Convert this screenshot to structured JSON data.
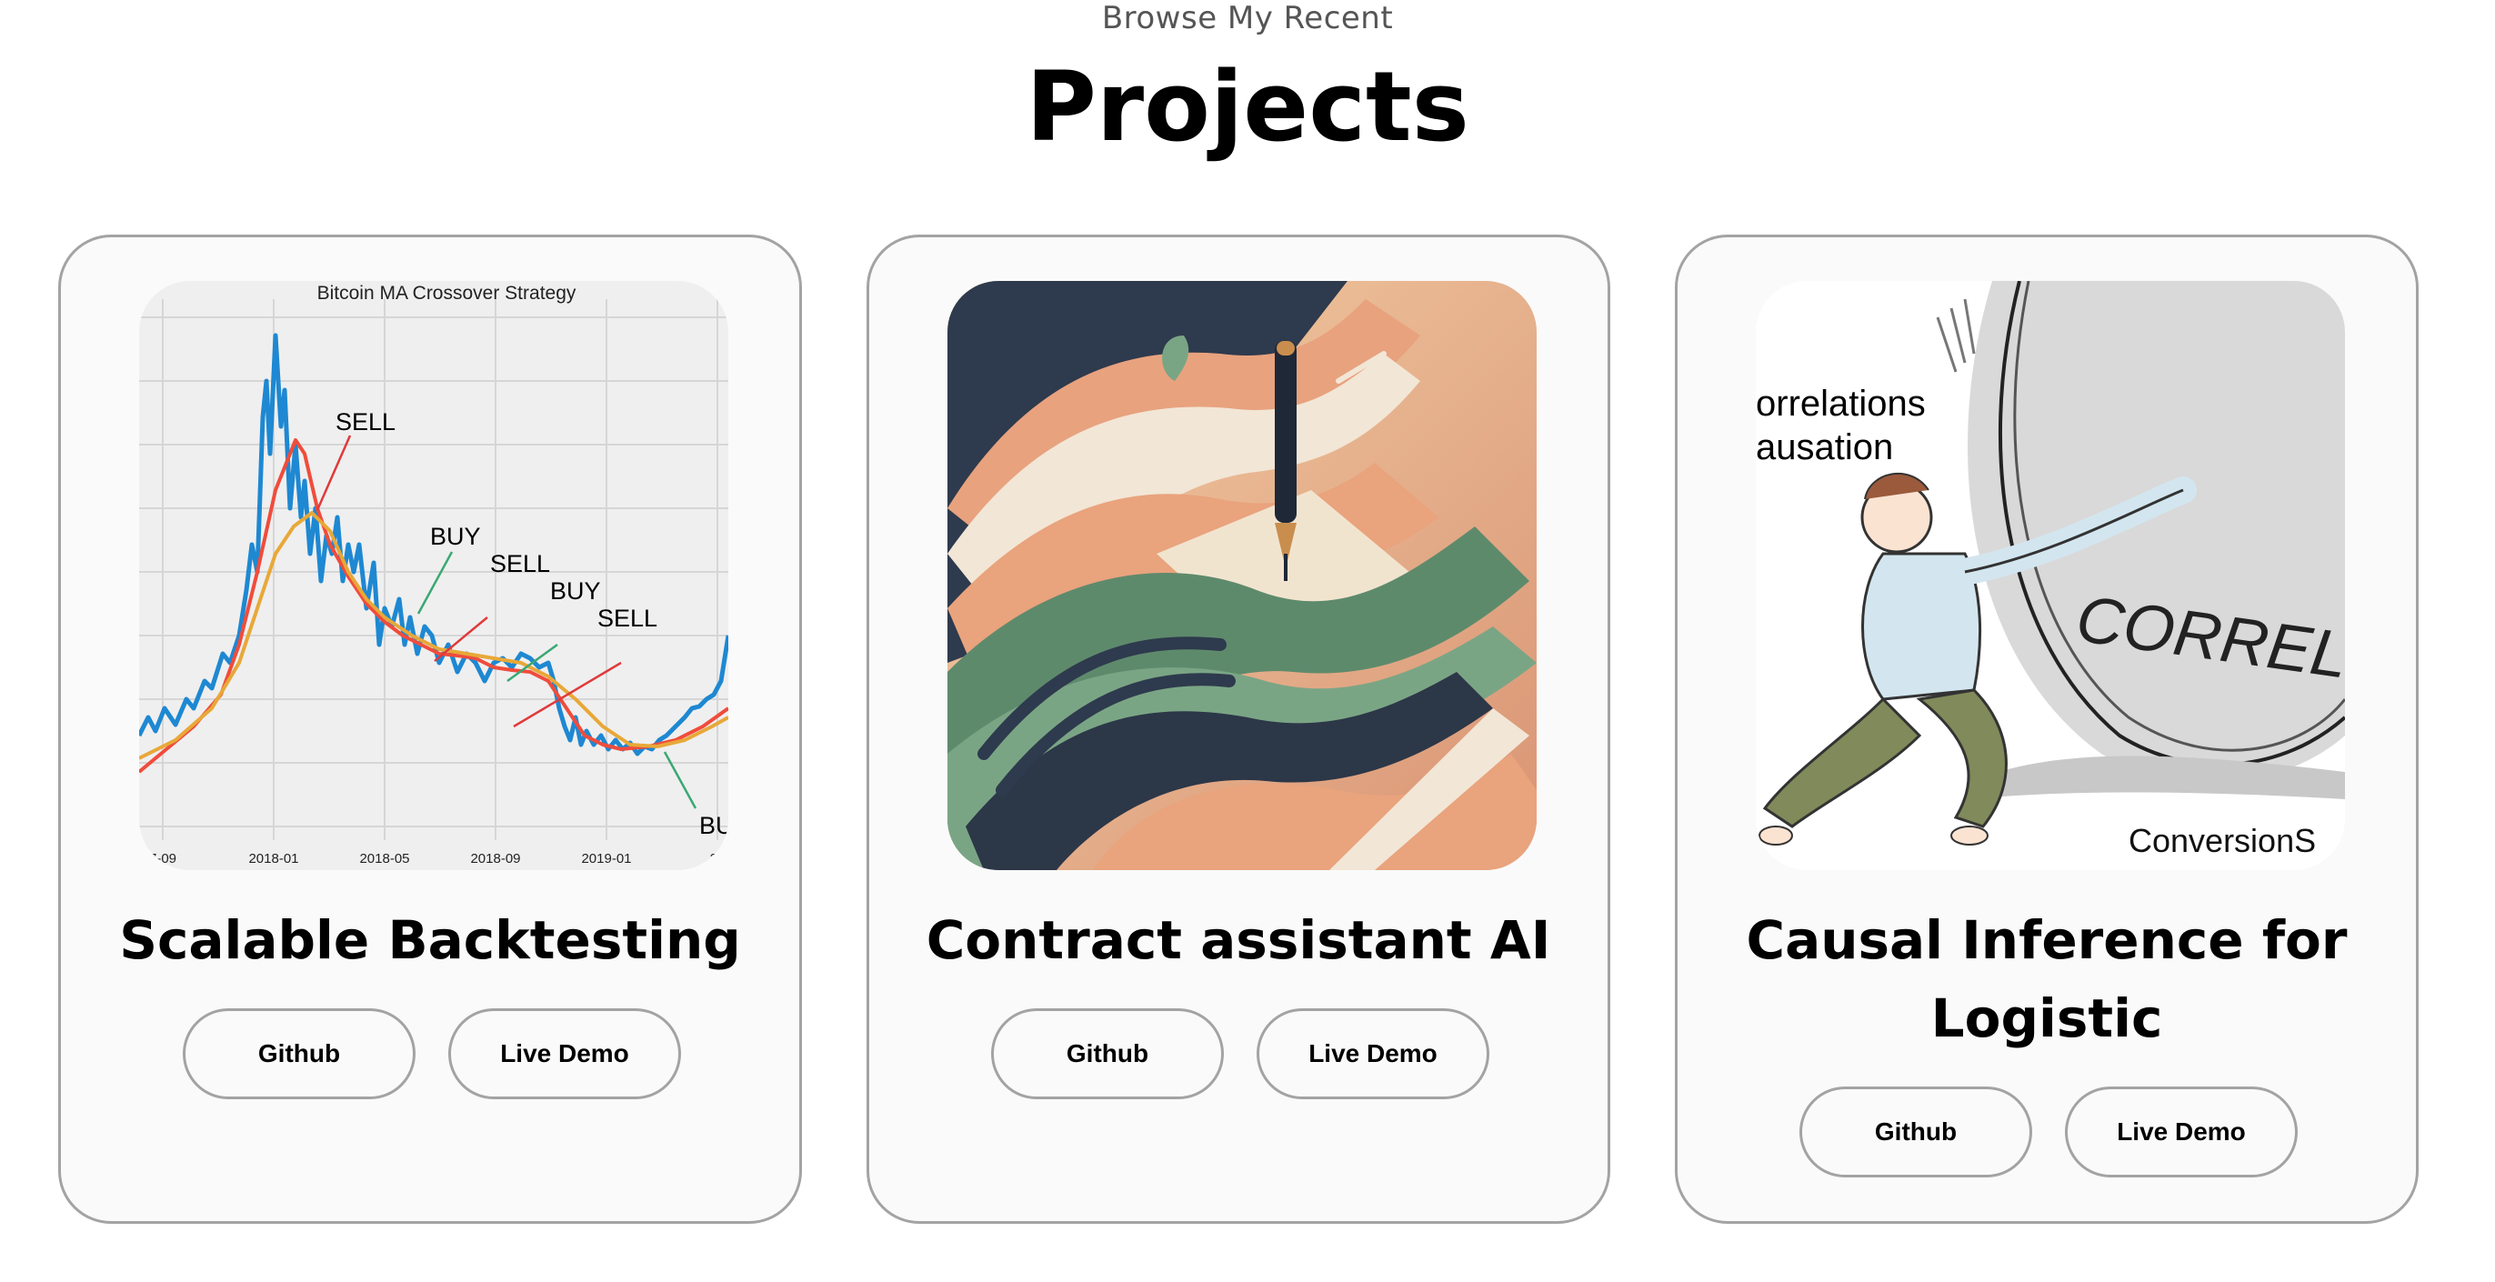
{
  "section": {
    "subtitle": "Browse My Recent",
    "title": "Projects"
  },
  "projects": [
    {
      "title": "Scalable Backtesting",
      "github_label": "Github",
      "demo_label": "Live Demo",
      "image": {
        "chart_title": "Bitcoin MA Crossover Strategy",
        "annotations": [
          "SELL",
          "BUY",
          "SELL",
          "BUY",
          "SELL",
          "BU"
        ],
        "x_ticks": [
          "7-09",
          "2018-01",
          "2018-05",
          "2018-09",
          "2019-01",
          "20"
        ]
      }
    },
    {
      "title": "Contract assistant AI",
      "github_label": "Github",
      "demo_label": "Live Demo"
    },
    {
      "title": "Causal Inference for Logistic",
      "github_label": "Github",
      "demo_label": "Live Demo",
      "image": {
        "texts": [
          "orrelations",
          "ausation",
          "CORREL",
          "ConversionS"
        ]
      }
    }
  ],
  "colors": {
    "card_border": "#a3a3a3",
    "card_bg": "#fafafa",
    "price_line": "#1e88d2",
    "fast_ma": "#f04c3c",
    "slow_ma": "#e8a838",
    "buy_arrow": "#3aa874",
    "sell_arrow": "#e03a3a"
  }
}
